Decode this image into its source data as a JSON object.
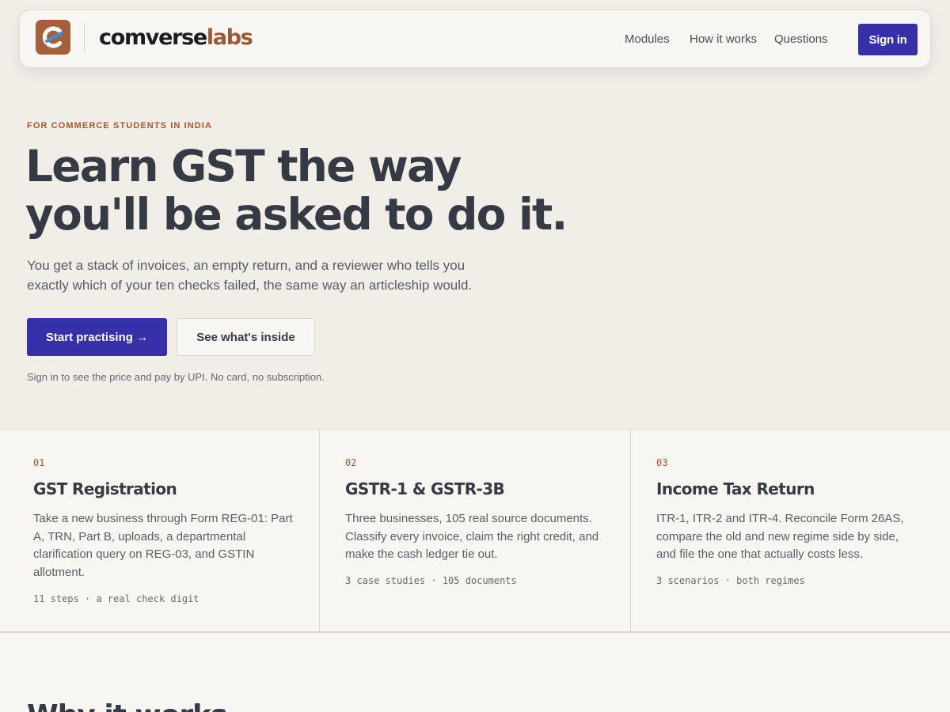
{
  "header": {
    "brand_part1": "comverse",
    "brand_part2": "labs",
    "nav": [
      "Modules",
      "How it works",
      "Questions"
    ],
    "sign_in": "Sign in"
  },
  "hero": {
    "eyebrow": "FOR COMMERCE STUDENTS IN INDIA",
    "headline_lines": [
      "Learn GST the way",
      "you'll be asked to do it."
    ],
    "lede_lines": [
      "You get a stack of invoices, an empty return, and a reviewer who tells you",
      "exactly which of your ten checks failed, the same way an articleship would."
    ],
    "primary_cta": "Start practising →",
    "secondary_cta": "See what's inside",
    "fineprint": "Sign in to see the price and pay by UPI. No card, no subscription."
  },
  "modules": [
    {
      "number": "01",
      "title": "GST Registration",
      "desc_lines": [
        "Take a new business through Form REG-01: Part",
        "A, TRN, Part B, uploads, a departmental",
        "clarification query on REG-03, and GSTIN",
        "allotment."
      ],
      "meta": "11 steps · a real check digit"
    },
    {
      "number": "02",
      "title": "GSTR-1 & GSTR-3B",
      "desc_lines": [
        "Three businesses, 105 real source documents.",
        "Classify every invoice, claim the right credit, and",
        "make the cash ledger tie out."
      ],
      "meta": "3 case studies · 105 documents"
    },
    {
      "number": "03",
      "title": "Income Tax Return",
      "desc_lines": [
        "ITR-1, ITR-2 and ITR-4. Reconcile Form 26AS,",
        "compare the old and new regime side by side,",
        "and file the one that actually costs less."
      ],
      "meta": "3 scenarios · both regimes"
    }
  ],
  "why": {
    "heading": "Why it works"
  },
  "colors": {
    "accent": "#3730a8",
    "brand_brown": "#a3603a",
    "eyebrow": "#a8552b",
    "background": "#f1eee8",
    "surface": "#f8f6f2",
    "text": "#353a45"
  },
  "icons": {
    "logo": "comverse-logo-icon",
    "cta_arrow": "arrow-right-icon"
  }
}
